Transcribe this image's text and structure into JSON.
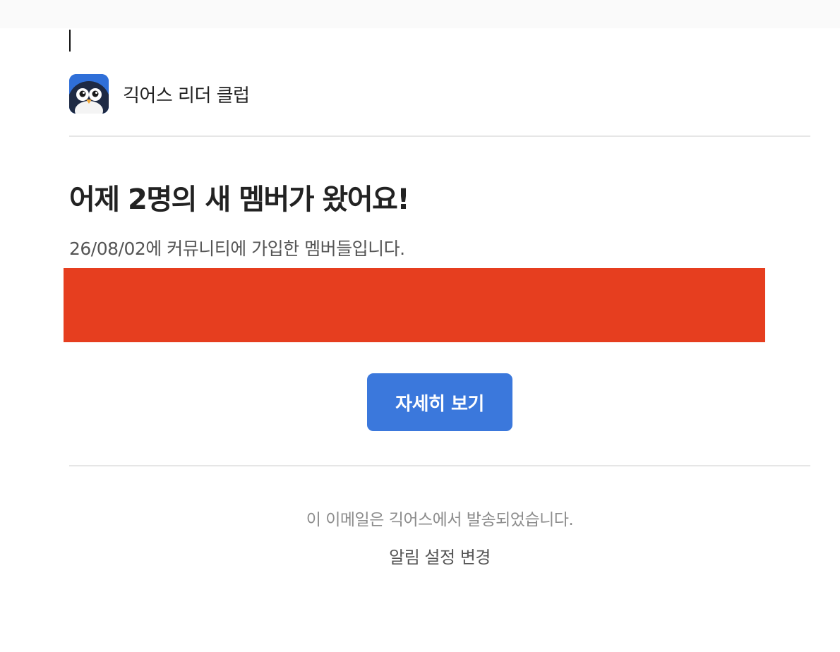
{
  "header": {
    "club_name": "긱어스 리더 클럽",
    "logo_icon": "penguin-icon"
  },
  "main": {
    "headline": "어제 2명의 새 멤버가 왔어요!",
    "subline": "26/08/02에 커뮤니티에 가입한 멤버들입니다.",
    "cta_label": "자세히 보기"
  },
  "footer": {
    "note": "이 이메일은 긱어스에서 발송되었습니다.",
    "settings_link": "알림 설정 변경"
  },
  "colors": {
    "accent": "#3b78dc",
    "redaction": "#e63e1f",
    "logo_bg": "#2f6fd8"
  }
}
